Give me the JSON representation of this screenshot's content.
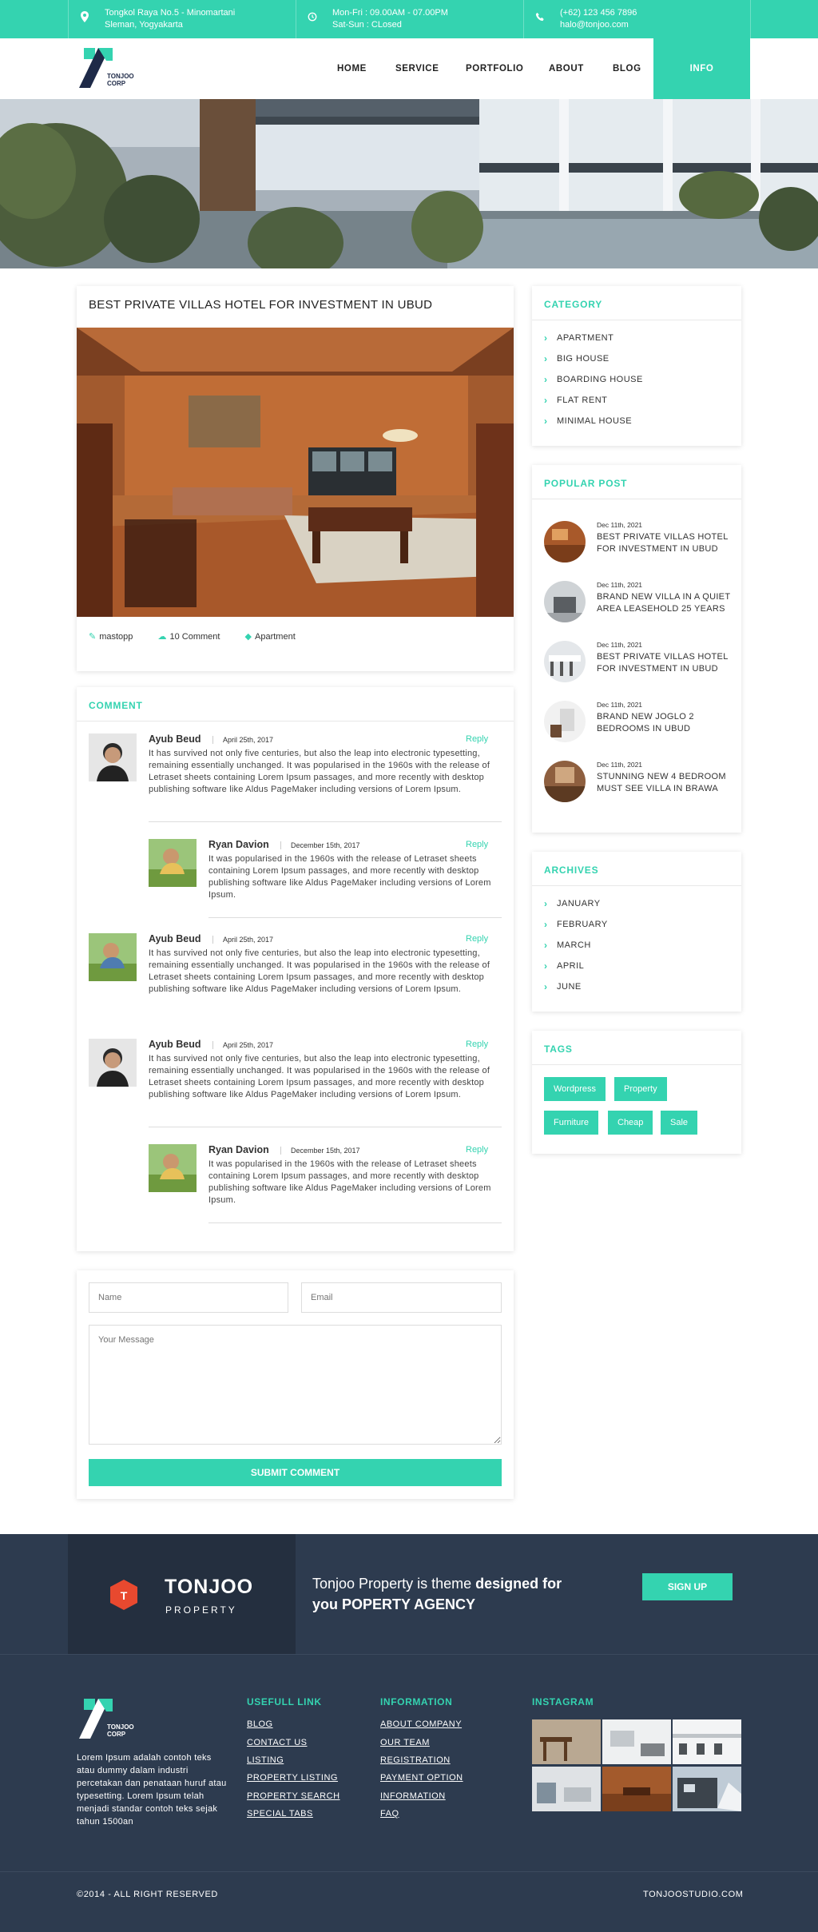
{
  "topbar": {
    "address_line1": "Tongkol Raya No.5 - Minomartani",
    "address_line2": "Sleman, Yogyakarta",
    "hours_line1": "Mon-Fri : 09.00AM - 07.00PM",
    "hours_line2": "Sat-Sun : CLosed",
    "phone": "(+62) 123 456 7896",
    "email": "halo@tonjoo.com"
  },
  "brand": {
    "logo_line1": "TONJOO",
    "logo_line2": "CORP"
  },
  "nav": {
    "items": [
      "HOME",
      "SERVICE",
      "PORTFOLIO",
      "ABOUT",
      "BLOG"
    ],
    "highlight": "INFO KORONA"
  },
  "post": {
    "title": "BEST PRIVATE VILLAS HOTEL FOR INVESTMENT IN UBUD",
    "author": "mastopp",
    "comments": "10 Comment",
    "category": "Apartment"
  },
  "comments": {
    "title": "COMMENT",
    "reply_label": "Reply",
    "items": [
      {
        "name": "Ayub Beud",
        "date": "April 25th, 2017",
        "body": "It has survived not only five centuries, but also the leap into electronic typesetting, remaining essentially unchanged. It was popularised in the 1960s with the release of Letraset sheets containing Lorem Ipsum passages, and more recently with desktop publishing software like Aldus PageMaker including versions of Lorem Ipsum."
      },
      {
        "name": "Ryan Davion",
        "date": "December 15th, 2017",
        "body": "It was popularised in the 1960s with the release of Letraset sheets containing Lorem Ipsum passages, and more recently with desktop publishing software like Aldus PageMaker including versions of Lorem Ipsum."
      },
      {
        "name": "Ayub Beud",
        "date": "April 25th, 2017",
        "body": "It has survived not only five centuries, but also the leap into electronic typesetting, remaining essentially unchanged. It was popularised in the 1960s with the release of Letraset sheets containing Lorem Ipsum passages, and more recently with desktop publishing software like Aldus PageMaker including versions of Lorem Ipsum."
      },
      {
        "name": "Ayub Beud",
        "date": "April 25th, 2017",
        "body": "It has survived not only five centuries, but also the leap into electronic typesetting, remaining essentially unchanged. It was popularised in the 1960s with the release of Letraset sheets containing Lorem Ipsum passages, and more recently with desktop publishing software like Aldus PageMaker including versions of Lorem Ipsum."
      },
      {
        "name": "Ryan Davion",
        "date": "December 15th, 2017",
        "body": "It was popularised in the 1960s with the release of Letraset sheets containing Lorem Ipsum passages, and more recently with desktop publishing software like Aldus PageMaker including versions of Lorem Ipsum."
      }
    ]
  },
  "form": {
    "name_placeholder": "Name",
    "email_placeholder": "Email",
    "message_placeholder": "Your Message",
    "submit_label": "SUBMIT COMMENT"
  },
  "sidebar": {
    "category_title": "CATEGORY",
    "categories": [
      "APARTMENT",
      "BIG HOUSE",
      "BOARDING HOUSE",
      "FLAT RENT",
      "MINIMAL HOUSE"
    ],
    "popular_title": "POPULAR POST",
    "popular": [
      {
        "date": "Dec 11th, 2021",
        "title": "BEST PRIVATE VILLAS HOTEL FOR INVESTMENT IN UBUD"
      },
      {
        "date": "Dec 11th, 2021",
        "title": "BRAND NEW VILLA IN A QUIET AREA LEASEHOLD 25 YEARS"
      },
      {
        "date": "Dec 11th, 2021",
        "title": "BEST PRIVATE VILLAS HOTEL FOR INVESTMENT IN UBUD"
      },
      {
        "date": "Dec 11th, 2021",
        "title": "BRAND NEW JOGLO 2 BEDROOMS IN UBUD"
      },
      {
        "date": "Dec 11th, 2021",
        "title": "STUNNING NEW 4 BEDROOM MUST SEE VILLA IN BRAWA"
      }
    ],
    "archives_title": "ARCHIVES",
    "archives": [
      "JANUARY",
      "FEBRUARY",
      "MARCH",
      "APRIL",
      "JUNE"
    ],
    "tags_title": "TAGS",
    "tags": [
      "Wordpress",
      "Property",
      "Furniture",
      "Cheap",
      "Sale"
    ]
  },
  "cta": {
    "brand_name": "TONJOO",
    "brand_sub": "PROPERTY",
    "text_a": "Tonjoo Property is theme ",
    "text_b": "designed for",
    "text_c": "you POPERTY AGENCY",
    "signup_label": "SIGN UP"
  },
  "footer": {
    "logo_line1": "TONJOO",
    "logo_line2": "CORP",
    "about": "Lorem Ipsum adalah contoh teks atau dummy dalam industri percetakan dan penataan huruf atau typesetting. Lorem Ipsum telah menjadi standar contoh teks sejak tahun 1500an",
    "useful_title": "USEFULL LINK",
    "useful_links": [
      "BLOG",
      "CONTACT US",
      "LISTING",
      "PROPERTY LISTING",
      "PROPERTY SEARCH",
      "SPECIAL TABS"
    ],
    "info_title": "INFORMATION",
    "info_links": [
      "ABOUT COMPANY",
      "OUR TEAM",
      "REGISTRATION",
      "PAYMENT OPTION",
      "INFORMATION",
      "FAQ"
    ],
    "instagram_title": "INSTAGRAM",
    "copyright": "©2014 - ALL RIGHT RESERVED",
    "site": "TONJOOSTUDIO.COM"
  },
  "colors": {
    "accent": "#34d3b0",
    "dark": "#2d3b4f",
    "darker": "#242f3f",
    "cta_icon": "#e8492f"
  }
}
